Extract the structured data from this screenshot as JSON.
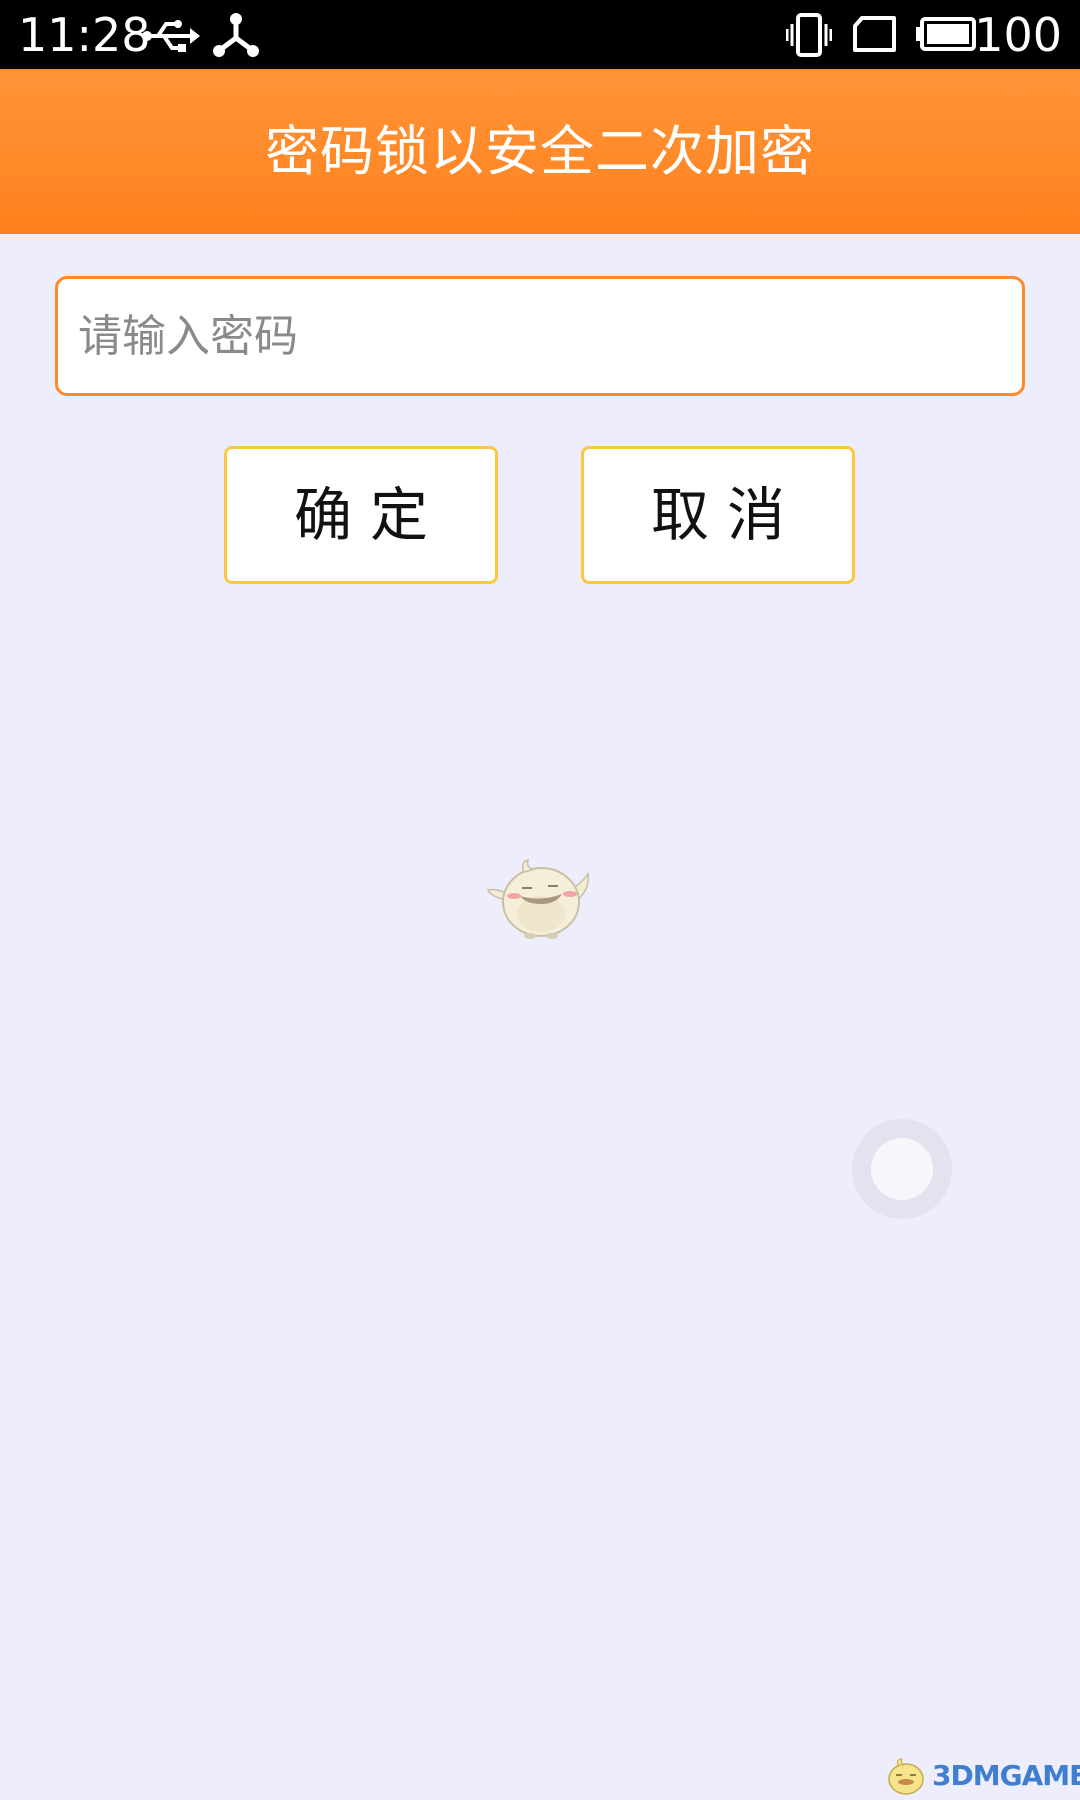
{
  "status_bar": {
    "time": "11:28",
    "battery": "100",
    "icons": [
      "usb-icon",
      "share-network-icon",
      "vibrate-icon",
      "no-sim-icon",
      "battery-icon"
    ]
  },
  "header": {
    "title": "密码锁以安全二次加密"
  },
  "password": {
    "placeholder": "请输入密码",
    "value": ""
  },
  "buttons": {
    "confirm_label": "确定",
    "cancel_label": "取消"
  },
  "colors": {
    "header_top": "#ff9437",
    "header_bottom": "#ff7f1d",
    "input_border": "#ff8a2b",
    "button_border": "#fbc842",
    "background": "#eeedfb"
  },
  "watermark": {
    "prefix": "3DM",
    "suffix": "GAME"
  }
}
